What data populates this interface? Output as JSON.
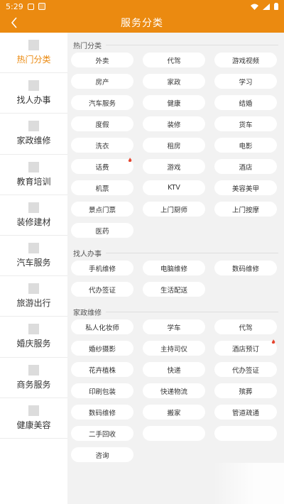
{
  "status_bar": {
    "time": "5:29"
  },
  "header": {
    "title": "服务分类",
    "back": "back"
  },
  "sidebar": {
    "items": [
      {
        "label": "热门分类",
        "active": true
      },
      {
        "label": "找人办事"
      },
      {
        "label": "家政维修"
      },
      {
        "label": "教育培训"
      },
      {
        "label": "装修建材"
      },
      {
        "label": "汽车服务"
      },
      {
        "label": "旅游出行"
      },
      {
        "label": "婚庆服务"
      },
      {
        "label": "商务服务"
      },
      {
        "label": "健康美容"
      }
    ]
  },
  "sections": [
    {
      "title": "热门分类",
      "items": [
        {
          "label": "外卖"
        },
        {
          "label": "代驾"
        },
        {
          "label": "游戏视频"
        },
        {
          "label": "房产"
        },
        {
          "label": "家政"
        },
        {
          "label": "学习"
        },
        {
          "label": "汽车服务"
        },
        {
          "label": "健康"
        },
        {
          "label": "结婚"
        },
        {
          "label": "度假"
        },
        {
          "label": "装修"
        },
        {
          "label": "货车"
        },
        {
          "label": "洗衣"
        },
        {
          "label": "租房"
        },
        {
          "label": "电影"
        },
        {
          "label": "话费",
          "hot": true
        },
        {
          "label": "游戏"
        },
        {
          "label": "酒店"
        },
        {
          "label": "机票"
        },
        {
          "label": "KTV"
        },
        {
          "label": "美容美甲"
        },
        {
          "label": "景点门票"
        },
        {
          "label": "上门厨师"
        },
        {
          "label": "上门按摩"
        },
        {
          "label": "医药"
        }
      ]
    },
    {
      "title": "找人办事",
      "items": [
        {
          "label": "手机维修"
        },
        {
          "label": "电脑维修"
        },
        {
          "label": "数码维修"
        },
        {
          "label": "代办签证"
        },
        {
          "label": "生活配送"
        }
      ]
    },
    {
      "title": "家政维修",
      "items": [
        {
          "label": "私人化妆师"
        },
        {
          "label": "学车"
        },
        {
          "label": "代驾"
        },
        {
          "label": "婚纱摄影"
        },
        {
          "label": "主持司仪"
        },
        {
          "label": "酒店预订",
          "hot": true
        },
        {
          "label": "花卉植株"
        },
        {
          "label": "快递"
        },
        {
          "label": "代办签证"
        },
        {
          "label": "印刷包装"
        },
        {
          "label": "快递物流"
        },
        {
          "label": "殡葬"
        },
        {
          "label": "数码维修"
        },
        {
          "label": "搬家"
        },
        {
          "label": "管道疏通"
        },
        {
          "label": "二手回收"
        },
        {
          "label": ""
        },
        {
          "label": ""
        },
        {
          "label": "咨询"
        }
      ]
    }
  ],
  "colors": {
    "accent": "#eb8a10",
    "hot": "#e5452f"
  }
}
